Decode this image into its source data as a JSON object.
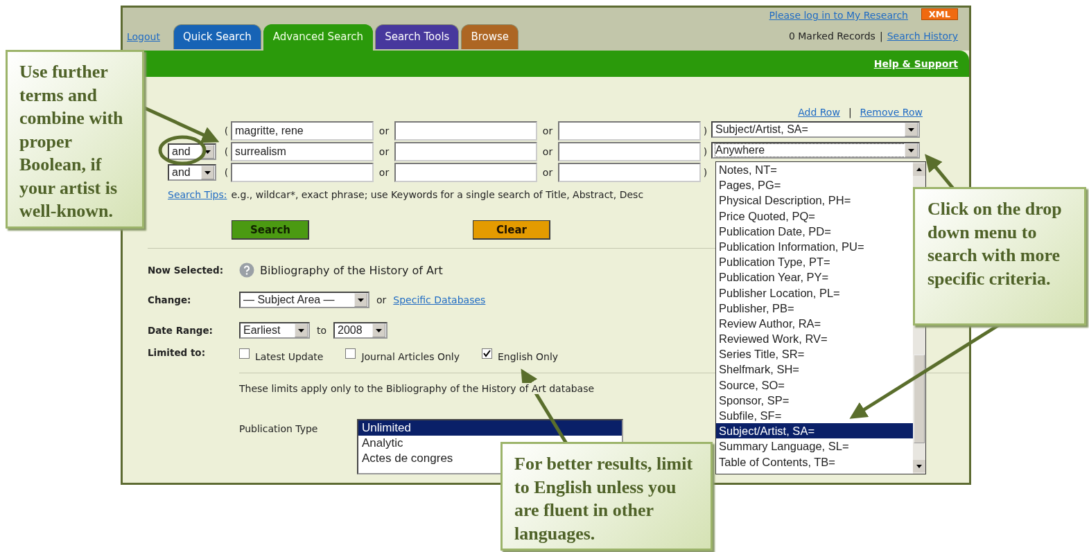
{
  "header": {
    "login_link": "Please log in to My Research",
    "xml_badge": "XML",
    "logout_link": "Logout",
    "marked_records": "0 Marked Records",
    "separator": "|",
    "history_link": "Search History"
  },
  "tabs": [
    {
      "label": "Quick Search",
      "color": "#1763b5",
      "selected": false
    },
    {
      "label": "Advanced Search",
      "color": "#2b9a0b",
      "selected": true
    },
    {
      "label": "Search Tools",
      "color": "#47389d",
      "selected": false
    },
    {
      "label": "Browse",
      "color": "#ad6623",
      "selected": false
    }
  ],
  "help_link": "Help & Support",
  "row_links": {
    "add": "Add Row",
    "separator": "|",
    "remove": "Remove Row"
  },
  "search_rows": [
    {
      "open_paren": "(",
      "fields": [
        {
          "kind": "input",
          "value": "magritte, rene"
        },
        {
          "kind": "input"
        },
        {
          "kind": "input"
        }
      ],
      "or_labels": [
        "or",
        "or"
      ],
      "close_paren": ")",
      "field_select": "Subject/Artist, SA="
    },
    {
      "operator": "and",
      "open_paren": "(",
      "fields": [
        {
          "kind": "input",
          "value": "surrealism"
        },
        {
          "kind": "input"
        },
        {
          "kind": "input"
        }
      ],
      "or_labels": [
        "or",
        "or"
      ],
      "close_paren": ")",
      "field_select": "Anywhere",
      "focused": true
    },
    {
      "operator": "and",
      "open_paren": "(",
      "fields": [
        {
          "kind": "input"
        },
        {
          "kind": "input"
        },
        {
          "kind": "input"
        }
      ],
      "or_labels": [
        "or",
        "or"
      ],
      "close_paren": ")"
    }
  ],
  "field_dropdown": {
    "options": [
      {
        "label": "Notes, NT=",
        "selected": false
      },
      {
        "label": "Pages, PG=",
        "selected": false
      },
      {
        "label": "Physical Description, PH=",
        "selected": false
      },
      {
        "label": "Price Quoted, PQ=",
        "selected": false
      },
      {
        "label": "Publication Date, PD=",
        "selected": false
      },
      {
        "label": "Publication Information, PU=",
        "selected": false
      },
      {
        "label": "Publication Type, PT=",
        "selected": false
      },
      {
        "label": "Publication Year, PY=",
        "selected": false
      },
      {
        "label": "Publisher Location, PL=",
        "selected": false
      },
      {
        "label": "Publisher, PB=",
        "selected": false
      },
      {
        "label": "Review Author, RA=",
        "selected": false
      },
      {
        "label": "Reviewed Work, RV=",
        "selected": false
      },
      {
        "label": "Series Title, SR=",
        "selected": false
      },
      {
        "label": "Shelfmark, SH=",
        "selected": false
      },
      {
        "label": "Source, SO=",
        "selected": false
      },
      {
        "label": "Sponsor, SP=",
        "selected": false
      },
      {
        "label": "Subfile, SF=",
        "selected": false
      },
      {
        "label": "Subject/Artist, SA=",
        "selected": true
      },
      {
        "label": "Summary Language, SL=",
        "selected": false
      },
      {
        "label": "Table of Contents, TB=",
        "selected": false
      }
    ]
  },
  "search_tips": {
    "link": "Search Tips:",
    "text": "e.g., wildcar*, exact phrase; use Keywords for a single search of Title, Abstract, Desc"
  },
  "buttons": [
    {
      "label": "Search",
      "kind": "search"
    },
    {
      "label": "Clear",
      "kind": "clear"
    }
  ],
  "now_selected": {
    "label": "Now Selected:",
    "value": "Bibliography of the History of Art"
  },
  "change": {
    "label": "Change:",
    "select": "— Subject Area —",
    "or": "or",
    "link": "Specific Databases"
  },
  "date_range": {
    "label": "Date Range:",
    "from": "Earliest",
    "to_label": "to",
    "to": "2008"
  },
  "limits": {
    "label": "Limited to:",
    "options": [
      {
        "label": "Latest Update",
        "checked": false
      },
      {
        "label": "Journal Articles Only",
        "checked": false
      },
      {
        "label": "English Only",
        "checked": true
      }
    ],
    "note": "These limits apply only to the Bibliography of the History of Art database"
  },
  "publication_type": {
    "label": "Publication Type",
    "options": [
      {
        "label": "Unlimited",
        "selected": true
      },
      {
        "label": "Analytic",
        "selected": false
      },
      {
        "label": "Actes de congres",
        "selected": false
      }
    ]
  },
  "callouts": [
    {
      "text": "Use further terms and combine with proper Boolean, if your artist is well-known."
    },
    {
      "text": "Click on the drop down menu to search with more specific criteria."
    },
    {
      "text": "For better results, limit to English unless you are fluent in other languages."
    }
  ]
}
